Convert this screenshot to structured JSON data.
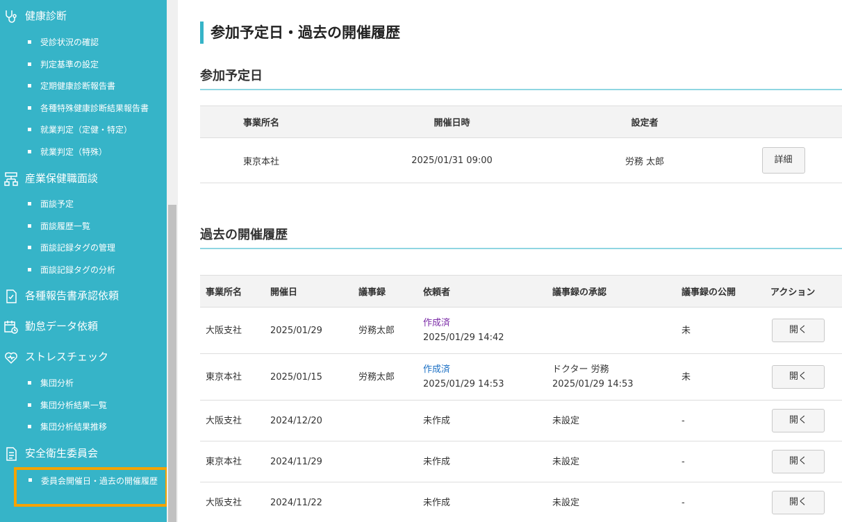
{
  "sidebar": {
    "sections": [
      {
        "label": "健康診断",
        "icon": "stethoscope-icon"
      },
      {
        "label": "産業保健職面談",
        "icon": "org-chart-icon"
      },
      {
        "label": "各種報告書承認依頼",
        "icon": "checklist-document-icon"
      },
      {
        "label": "勤怠データ依頼",
        "icon": "calendar-clock-icon"
      },
      {
        "label": "ストレスチェック",
        "icon": "heart-icon"
      },
      {
        "label": "安全衛生委員会",
        "icon": "document-icon"
      }
    ],
    "health_items": [
      "受診状況の確認",
      "判定基準の設定",
      "定期健康診断報告書",
      "各種特殊健康診断結果報告書",
      "就業判定（定健・特定）",
      "就業判定（特殊）"
    ],
    "interview_items": [
      "面談予定",
      "面談履歴一覧",
      "面談記録タグの管理",
      "面談記録タグの分析"
    ],
    "stress_items": [
      "集団分析",
      "集団分析結果一覧",
      "集団分析結果推移"
    ],
    "committee_items": [
      "委員会開催日・過去の開催履歴"
    ],
    "accent_color": "#36b4c8",
    "highlight_color": "#f5a300"
  },
  "main": {
    "page_title": "参加予定日・過去の開催履歴",
    "upcoming": {
      "heading": "参加予定日",
      "columns": [
        "事業所名",
        "開催日時",
        "設定者"
      ],
      "rows": [
        {
          "office": "東京本社",
          "datetime": "2025/01/31 09:00",
          "setter": "労務 太郎",
          "button": "詳細"
        }
      ]
    },
    "history": {
      "heading": "過去の開催履歴",
      "columns": [
        "事業所名",
        "開催日",
        "議事録",
        "依頼者",
        "議事録の承認",
        "議事録の公開",
        "アクション"
      ],
      "rows": [
        {
          "office": "大阪支社",
          "date": "2025/01/29",
          "minutes": "労務太郎",
          "requester_status": "作成済",
          "requester_time": "2025/01/29 14:42",
          "approval_name": "",
          "approval_time": "",
          "published": "未",
          "action": "開く"
        },
        {
          "office": "東京本社",
          "date": "2025/01/15",
          "minutes": "労務太郎",
          "requester_status": "作成済",
          "requester_time": "2025/01/29 14:53",
          "approval_name": "ドクター 労務",
          "approval_time": "2025/01/29 14:53",
          "published": "未",
          "action": "開く"
        },
        {
          "office": "大阪支社",
          "date": "2024/12/20",
          "minutes": "",
          "requester_status": "未作成",
          "requester_time": "",
          "approval_name": "未設定",
          "approval_time": "",
          "published": "-",
          "action": "開く"
        },
        {
          "office": "東京本社",
          "date": "2024/11/29",
          "minutes": "",
          "requester_status": "未作成",
          "requester_time": "",
          "approval_name": "未設定",
          "approval_time": "",
          "published": "-",
          "action": "開く"
        },
        {
          "office": "大阪支社",
          "date": "2024/11/22",
          "minutes": "",
          "requester_status": "未作成",
          "requester_time": "",
          "approval_name": "未設定",
          "approval_time": "",
          "published": "-",
          "action": "開く"
        }
      ]
    }
  }
}
